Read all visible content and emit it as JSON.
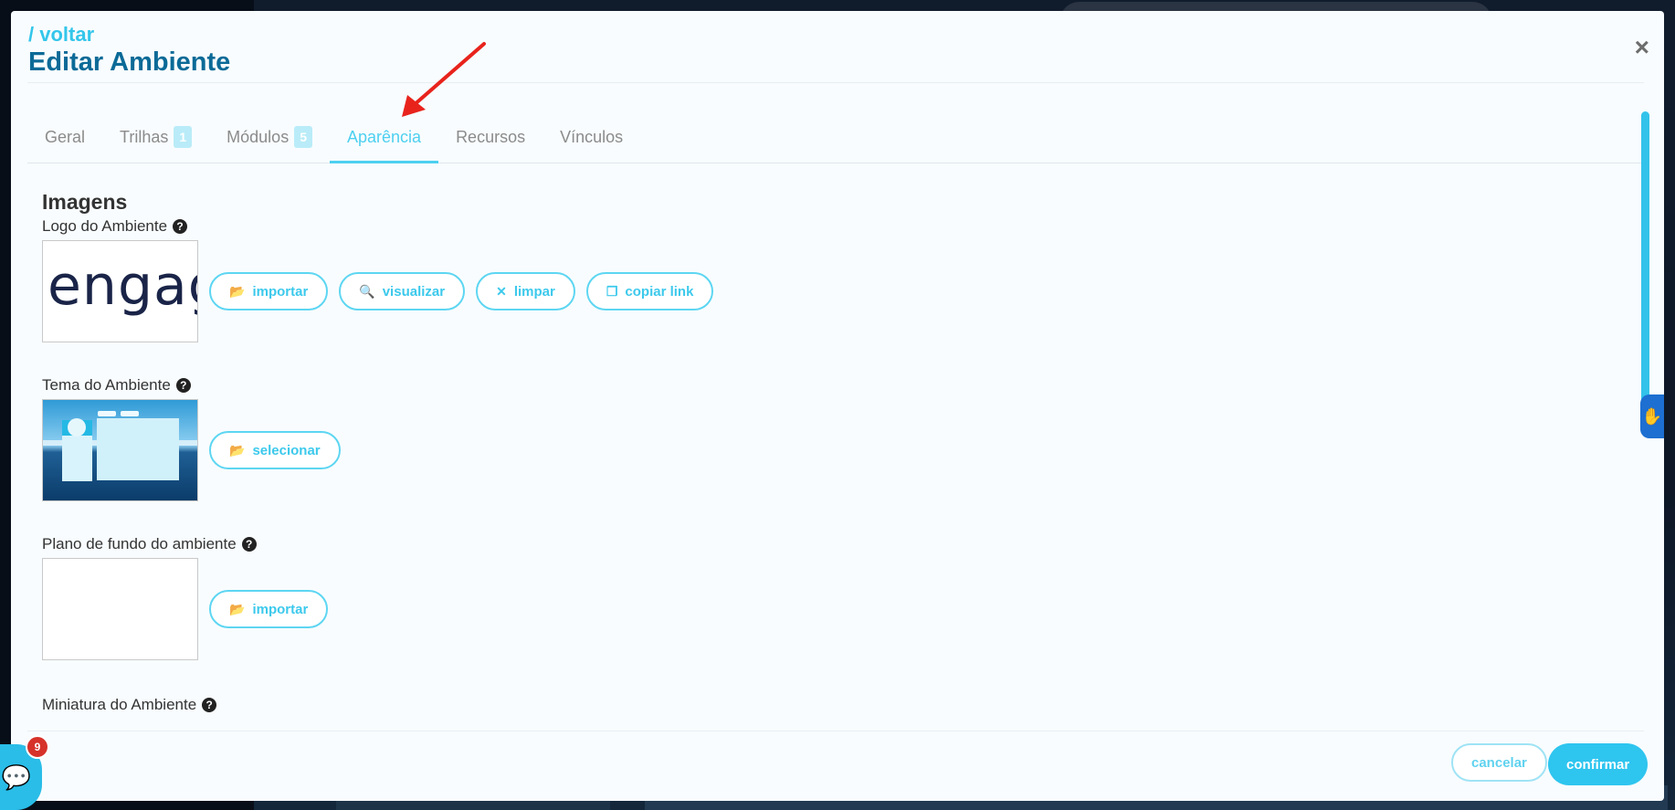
{
  "header": {
    "back_label": "/ voltar",
    "title": "Editar Ambiente",
    "close_symbol": "×"
  },
  "tabs": [
    {
      "label": "Geral",
      "badge": null
    },
    {
      "label": "Trilhas",
      "badge": "1"
    },
    {
      "label": "Módulos",
      "badge": "5"
    },
    {
      "label": "Aparência",
      "badge": null,
      "active": true
    },
    {
      "label": "Recursos",
      "badge": null
    },
    {
      "label": "Vínculos",
      "badge": null
    }
  ],
  "content": {
    "section_title": "Imagens",
    "logo": {
      "label": "Logo do Ambiente",
      "preview_text": "engag",
      "buttons": [
        {
          "label": "importar",
          "icon": "folder-open-icon"
        },
        {
          "label": "visualizar",
          "icon": "search-icon"
        },
        {
          "label": "limpar",
          "icon": "close-icon"
        },
        {
          "label": "copiar link",
          "icon": "copy-icon"
        }
      ]
    },
    "theme": {
      "label": "Tema do Ambiente",
      "button": {
        "label": "selecionar",
        "icon": "folder-open-icon"
      }
    },
    "background": {
      "label": "Plano de fundo do ambiente",
      "button": {
        "label": "importar",
        "icon": "folder-open-icon"
      }
    },
    "thumbnail": {
      "label": "Miniatura do Ambiente"
    }
  },
  "footer": {
    "cancel_label": "cancelar",
    "confirm_label": "confirmar"
  },
  "chat": {
    "badge_count": "9"
  },
  "colors": {
    "accent": "#2ec5ef",
    "title": "#0b6a97",
    "badge_red": "#d6322a",
    "annotation_arrow": "#e8231c"
  }
}
